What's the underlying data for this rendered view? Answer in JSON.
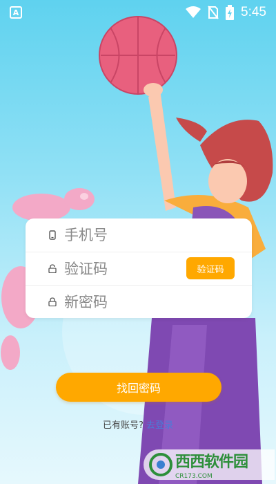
{
  "status_bar": {
    "left_icon": "A",
    "time": "5:45",
    "icons": [
      "wifi-icon",
      "no-sim-icon",
      "battery-charging-icon"
    ]
  },
  "form": {
    "phone": {
      "placeholder": "手机号",
      "icon": "phone-icon"
    },
    "code": {
      "placeholder": "验证码",
      "icon": "lock-icon",
      "button_label": "验证码"
    },
    "new_password": {
      "placeholder": "新密码",
      "icon": "lock-icon"
    }
  },
  "submit_label": "找回密码",
  "login_prompt": {
    "text": "已有账号?",
    "link": "去登录"
  },
  "watermark": {
    "main": "西西软件园",
    "sub": "CR173.COM"
  },
  "colors": {
    "accent": "#ffa800",
    "link": "#4a7cd8",
    "bg_top": "#5fd2ef",
    "bg_bottom": "#e6f8fd"
  }
}
